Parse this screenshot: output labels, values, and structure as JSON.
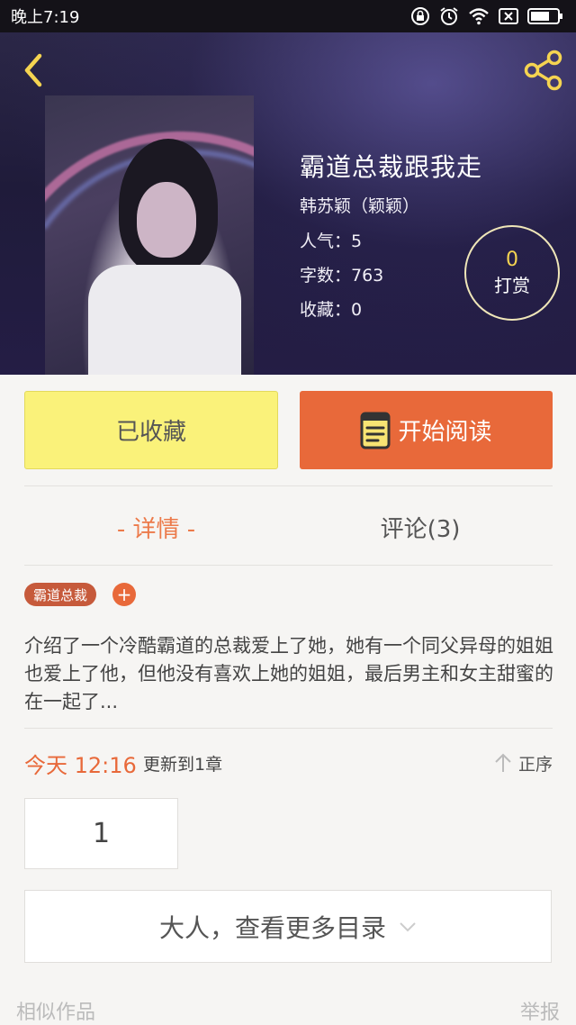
{
  "status_bar": {
    "time": "晚上7:19"
  },
  "header": {
    "back_icon": "chevron-left-icon",
    "share_icon": "share-icon",
    "accent_color": "#f5d451"
  },
  "book": {
    "title": "霸道总裁跟我走",
    "author": "韩苏颖（颖颖）",
    "popularity": "人气：5",
    "word_count": "字数：763",
    "favorites": "收藏：0"
  },
  "reward": {
    "count": "0",
    "label": "打赏"
  },
  "actions": {
    "collected_label": "已收藏",
    "read_label": "开始阅读",
    "collected_color": "#faf27a",
    "read_color": "#e8693a"
  },
  "tabs": [
    {
      "label": "- 详情 -",
      "active": true
    },
    {
      "label": "评论(3)",
      "active": false
    }
  ],
  "tags": {
    "items": [
      "霸道总裁"
    ],
    "add_label": "+"
  },
  "description": "介绍了一个冷酷霸道的总裁爱上了她，她有一个同父异母的姐姐也爱上了他，但他没有喜欢上她的姐姐，最后男主和女主甜蜜的在一起了...",
  "update": {
    "time": "今天 12:16",
    "text": "更新到1章",
    "sort_label": "正序"
  },
  "chapters": {
    "first": "1",
    "more_label": "大人，查看更多目录"
  },
  "footer": {
    "similar_label": "相似作品",
    "report_label": "举报"
  }
}
